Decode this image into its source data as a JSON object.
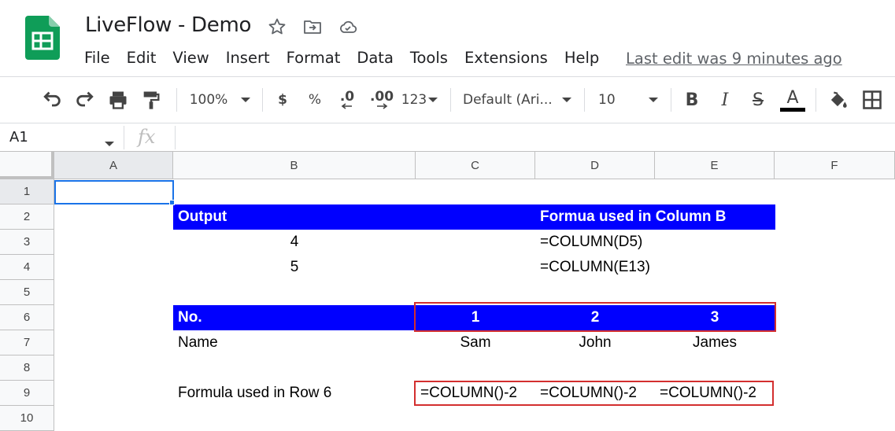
{
  "app": {
    "title": "LiveFlow - Demo",
    "last_edit": "Last edit was 9 minutes ago",
    "brand_color": "#0f9d58"
  },
  "menu": [
    "File",
    "Edit",
    "View",
    "Insert",
    "Format",
    "Data",
    "Tools",
    "Extensions",
    "Help"
  ],
  "toolbar": {
    "zoom": "100%",
    "currency": "$",
    "percent": "%",
    "decrease_decimal": ".0",
    "increase_decimal": ".00",
    "more_formats": "123",
    "font": "Default (Ari...",
    "font_size": "10",
    "bold": "B",
    "italic": "I",
    "strike": "S",
    "text_color": "A",
    "text_color_value": "#000000"
  },
  "formula_bar": {
    "name_box": "A1",
    "fx": "fx",
    "value": ""
  },
  "columns": [
    "A",
    "B",
    "C",
    "D",
    "E",
    "F"
  ],
  "rows": [
    "1",
    "2",
    "3",
    "4",
    "5",
    "6",
    "7",
    "8",
    "9",
    "10"
  ],
  "cells": {
    "B2": "Output",
    "D2": "Formua used in Column B",
    "B3": "4",
    "D3": "=COLUMN(D5)",
    "B4": "5",
    "D4": "=COLUMN(E13)",
    "B6": "No.",
    "C6": "1",
    "D6": "2",
    "E6": "3",
    "B7": "Name",
    "C7": "Sam",
    "D7": "John",
    "E7": "James",
    "B9": "Formula used in Row 6",
    "C9": "=COLUMN()-2",
    "D9": "=COLUMN()-2",
    "E9": "=COLUMN()-2"
  },
  "colors": {
    "header_fill": "#0000ff",
    "header_text": "#ffffff",
    "highlight_border": "#d32f2f",
    "selection": "#1a73e8"
  },
  "selected_cell": "A1"
}
